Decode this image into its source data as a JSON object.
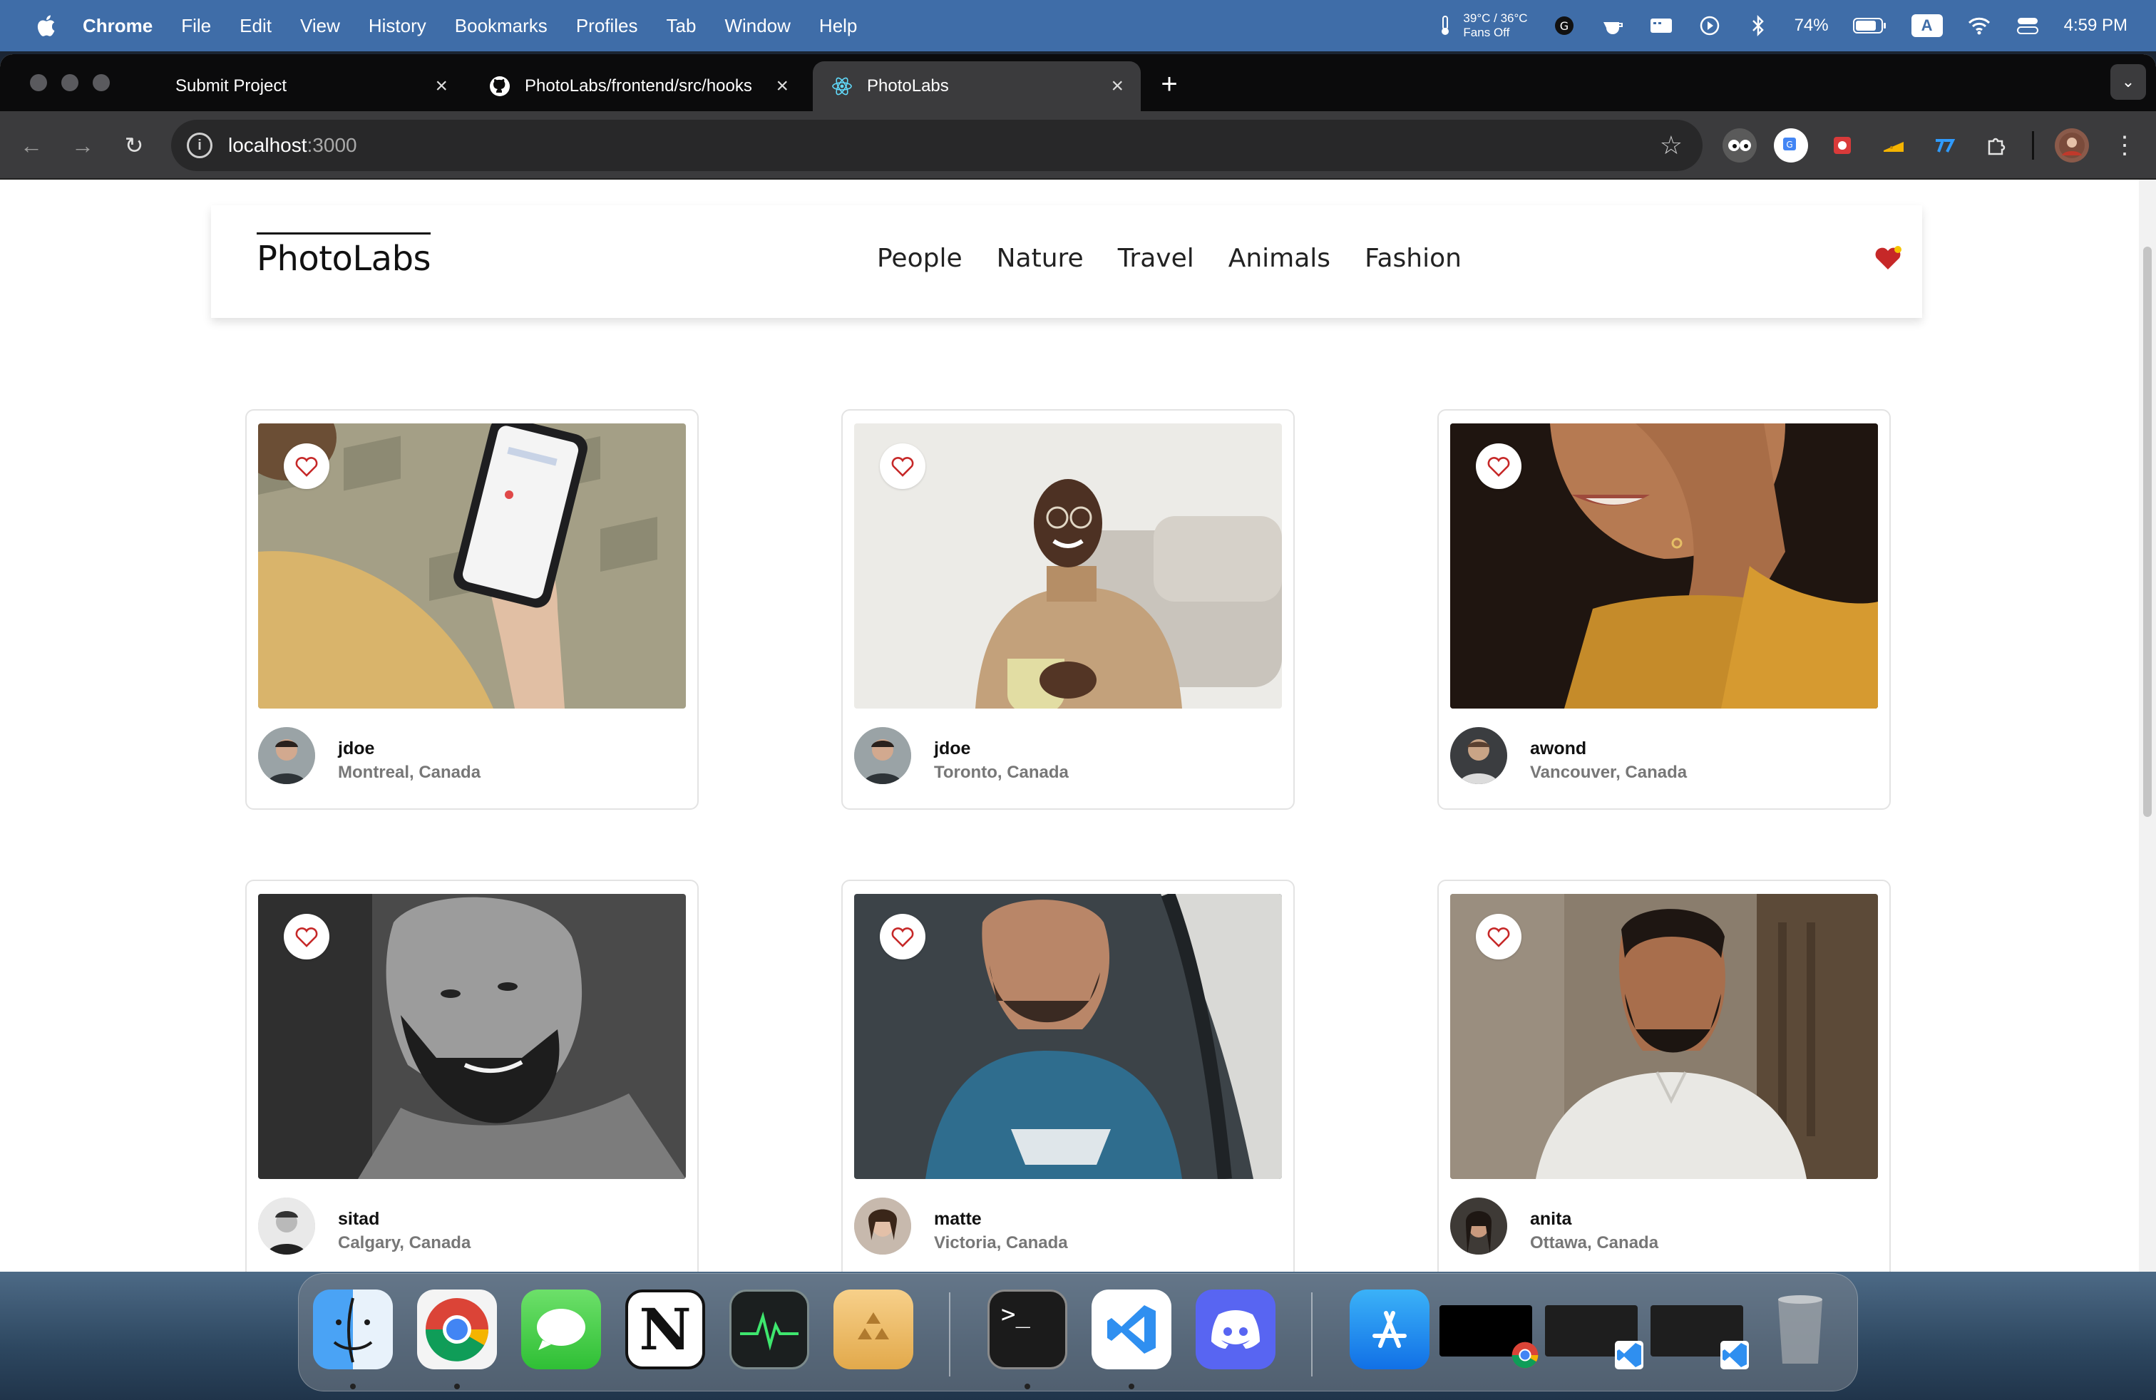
{
  "menubar": {
    "app": "Chrome",
    "items": [
      "File",
      "Edit",
      "View",
      "History",
      "Bookmarks",
      "Profiles",
      "Tab",
      "Window",
      "Help"
    ],
    "temp_line1": "39°C / 36°C",
    "temp_line2": "Fans Off",
    "battery": "74%",
    "input_source": "A",
    "clock": "4:59 PM"
  },
  "browser": {
    "tabs": [
      {
        "title": "Submit Project"
      },
      {
        "title": "PhotoLabs/frontend/src/hooks"
      },
      {
        "title": "PhotoLabs"
      }
    ],
    "url_host": "localhost",
    "url_port": ":3000"
  },
  "app": {
    "logo": "PhotoLabs",
    "topics": [
      "People",
      "Nature",
      "Travel",
      "Animals",
      "Fashion"
    ],
    "accent": "#c62828"
  },
  "photos": [
    {
      "username": "jdoe",
      "location": "Montreal, Canada"
    },
    {
      "username": "jdoe",
      "location": "Toronto, Canada"
    },
    {
      "username": "awond",
      "location": "Vancouver, Canada"
    },
    {
      "username": "sitad",
      "location": "Calgary, Canada"
    },
    {
      "username": "matte",
      "location": "Victoria, Canada"
    },
    {
      "username": "anita",
      "location": "Ottawa, Canada"
    }
  ],
  "dock": {
    "apps": [
      "Finder",
      "Google Chrome",
      "Messages",
      "Notion",
      "Activity Monitor",
      "Archive Utility",
      "Terminal",
      "Visual Studio Code",
      "Discord",
      "App Store",
      "Chrome window",
      "VS Code window",
      "VS Code window",
      "Trash"
    ]
  }
}
